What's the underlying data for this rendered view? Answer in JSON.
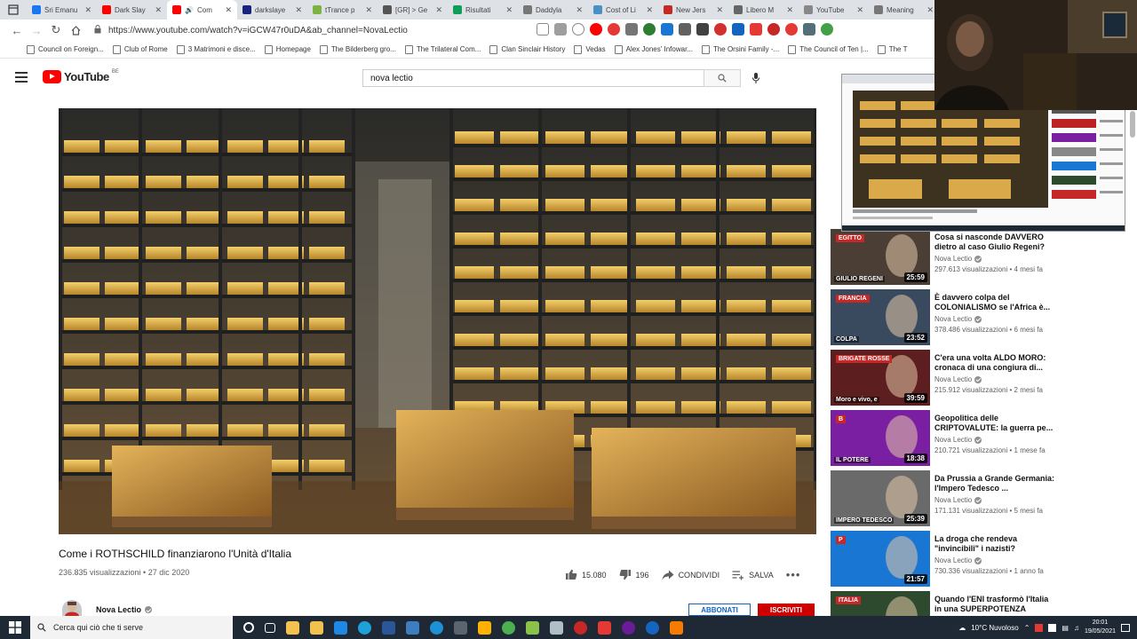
{
  "browser": {
    "tabs": [
      {
        "title": "Śri Emanu",
        "color": "#1877f2",
        "active": false
      },
      {
        "title": "Dark Slay",
        "color": "#ff0000",
        "active": false
      },
      {
        "title": "Com",
        "color": "#ff0000",
        "active": true
      },
      {
        "title": "darkslaye",
        "color": "#1a237e",
        "active": false
      },
      {
        "title": "tTrance p",
        "color": "#7cb342",
        "active": false
      },
      {
        "title": "[GR] > Ge",
        "color": "#555555",
        "active": false
      },
      {
        "title": "Risultati",
        "color": "#0f9d58",
        "active": false
      },
      {
        "title": "Daddyla",
        "color": "#777777",
        "active": false
      },
      {
        "title": "Cost of Li",
        "color": "#4a90c2",
        "active": false
      },
      {
        "title": "New Jers",
        "color": "#c62828",
        "active": false
      },
      {
        "title": "Libero M",
        "color": "#666666",
        "active": false
      },
      {
        "title": "YouTube",
        "color": "#888888",
        "active": false
      },
      {
        "title": "Meaning",
        "color": "#777777",
        "active": false
      }
    ],
    "url": "https://www.youtube.com/watch?v=iGCW47r0uDA&ab_channel=NovaLectio",
    "bookmarks": [
      "Council on Foreign...",
      "Club of Rome",
      "3 Matrimoni e disce...",
      "Homepage",
      "The Bilderberg gro...",
      "The Trilateral Com...",
      "Clan Sinclair History",
      "Vedas",
      "Alex Jones' Infowar...",
      "The Orsini Family -...",
      "The Council of Ten |...",
      "The T"
    ]
  },
  "youtube": {
    "logo_text": "YouTube",
    "country": "BE",
    "search_value": "nova lectio"
  },
  "video": {
    "title": "Come i ROTHSCHILD finanziarono l'Unità d'Italia",
    "meta": "236.835 visualizzazioni • 27 dic 2020",
    "likes": "15.080",
    "dislikes": "196",
    "share": "CONDIVIDI",
    "save": "SALVA",
    "more": "•••",
    "channel": "Nova Lectio",
    "join": "ABBONATI",
    "subscribe": "ISCRIVITI"
  },
  "recommendations": [
    {
      "title": "Cosa si nasconde DAVVERO dietro al caso Giulio Regeni?",
      "channel": "Nova Lectio",
      "meta": "297.613 visualizzazioni • 4 mesi fa",
      "duration": "25:59",
      "badge": "EGITTO",
      "caption": "GIULIO REGENI",
      "bg": "#4a3e35"
    },
    {
      "title": "È davvero colpa del COLONIALISMO se l'Africa è...",
      "channel": "Nova Lectio",
      "meta": "378.486 visualizzazioni • 6 mesi fa",
      "duration": "23:52",
      "badge": "FRANCIA",
      "caption": "COLPA",
      "bg": "#3a4a5e"
    },
    {
      "title": "C'era una volta ALDO MORO: cronaca di una congiura di...",
      "channel": "Nova Lectio",
      "meta": "215.912 visualizzazioni • 2 mesi fa",
      "duration": "39:59",
      "badge": "BRIGATE ROSSE",
      "caption": "Moro e vivo, e",
      "bg": "#5c1e1e"
    },
    {
      "title": "Geopolitica delle CRIPTOVALUTE: la guerra pe...",
      "channel": "Nova Lectio",
      "meta": "210.721 visualizzazioni • 1 mese fa",
      "duration": "18:38",
      "badge": "B",
      "caption": "IL POTERE",
      "bg": "#7b1fa2"
    },
    {
      "title": "Da Prussia a Grande Germania: l'Impero Tedesco ...",
      "channel": "Nova Lectio",
      "meta": "171.131 visualizzazioni • 5 mesi fa",
      "duration": "25:39",
      "badge": "",
      "caption": "IMPERO TEDESCO",
      "bg": "#6a6a6a"
    },
    {
      "title": "La droga che rendeva \"invincibili\" i nazisti?",
      "channel": "Nova Lectio",
      "meta": "730.336 visualizzazioni • 1 anno fa",
      "duration": "21:57",
      "badge": "P",
      "caption": "",
      "bg": "#1976d2"
    },
    {
      "title": "Quando l'ENI trasformò l'Italia in una SUPERPOTENZA",
      "channel": "",
      "meta": "",
      "duration": "",
      "badge": "ITALIA",
      "caption": "",
      "bg": "#2e4a2e"
    }
  ],
  "taskbar": {
    "search_placeholder": "Cerca qui ciò che ti serve",
    "weather": "10°C Nuvoloso",
    "time": "20:01",
    "date": "19/05/2021"
  },
  "colors": {
    "yt_red": "#ff0000",
    "subscribe_red": "#cc0000",
    "join_blue": "#1565c0",
    "taskbar": "#1f2936"
  }
}
